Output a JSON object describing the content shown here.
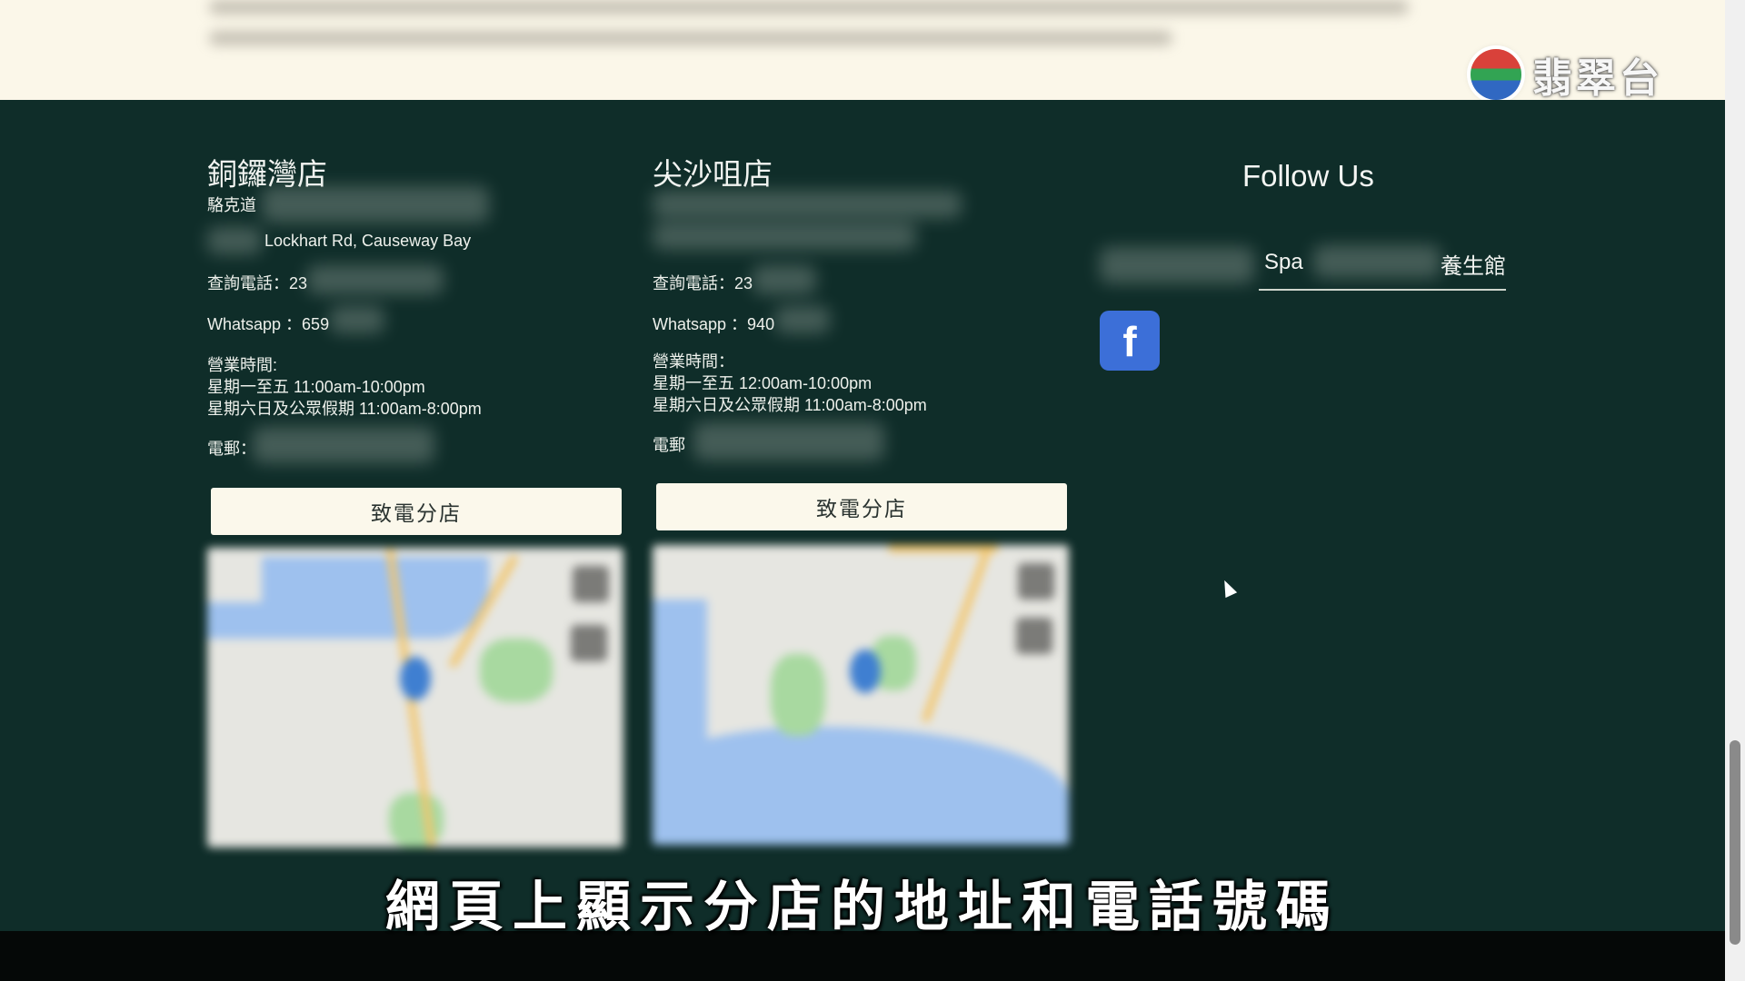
{
  "logo": {
    "text": "翡翠台"
  },
  "stores": [
    {
      "name": "銅鑼灣店",
      "address_line1": "駱克道",
      "address_line2": "Lockhart Rd, Causeway Bay",
      "phone": "查詢電話：23",
      "whatsapp": "Whatsapp ：659",
      "hours_label": "營業時間:",
      "hours_weekday": "星期一至五 11:00am-10:00pm",
      "hours_weekend": "星期六日及公眾假期 11:00am-8:00pm",
      "email_label": "電郵：",
      "call_button": "致電分店"
    },
    {
      "name": "尖沙咀店",
      "phone": "查詢電話：23",
      "whatsapp": "Whatsapp ：940",
      "hours_label": "營業時間：",
      "hours_weekday": "星期一至五 12:00am-10:00pm",
      "hours_weekend": "星期六日及公眾假期 11:00am-8:00pm",
      "email_label": "電郵",
      "call_button": "致電分店"
    }
  ],
  "follow": {
    "title": "Follow Us",
    "link_part1": "Spa",
    "link_part2": "養生館",
    "facebook_glyph": "f"
  },
  "subtitle": "網頁上顯示分店的地址和電話號碼"
}
